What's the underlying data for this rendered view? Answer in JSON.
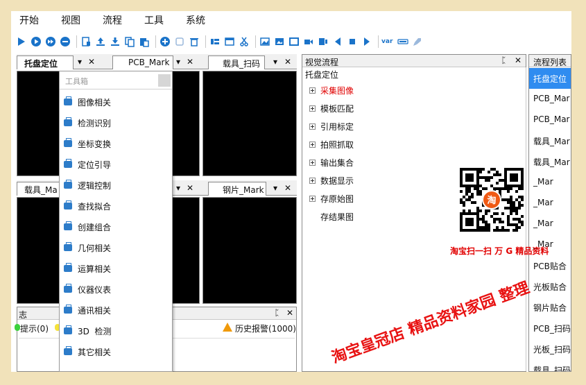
{
  "menu": [
    "开始",
    "视图",
    "流程",
    "工具",
    "系统"
  ],
  "toolbar": {
    "icons": [
      "run-icon",
      "run-once-icon",
      "step-icon",
      "stop-icon",
      "save-icon",
      "upload-icon",
      "download-icon",
      "copy-icon",
      "paste-icon",
      "add-icon",
      "duplicate-icon",
      "delete-icon",
      "list-icon",
      "window-icon",
      "cut-icon",
      "image-icon",
      "image-edit-icon",
      "frame-icon",
      "camera-icon",
      "layers-icon",
      "prev-icon",
      "square-icon",
      "next-icon",
      "var-icon",
      "io-icon",
      "rocket-icon"
    ],
    "var_label": "var",
    "accent": "#1a73c9"
  },
  "panes": {
    "tab1": "托盘定位",
    "tab2": "PCB_Mark",
    "tab3": "载具_扫码",
    "tab4": "载具_Ma",
    "tab5": "钢片_Mark",
    "pin": "▾",
    "close": "✕"
  },
  "toolbox": {
    "title": "工具箱",
    "items": [
      "图像相关",
      "检测识别",
      "坐标变换",
      "定位引导",
      "逻辑控制",
      "查找拟合",
      "创建组合",
      "几何相关",
      "运算相关",
      "仪器仪表",
      "通讯相关",
      "3D  检测",
      "其它相关"
    ]
  },
  "log": {
    "title": "志",
    "pin": "ᛈ",
    "close": "✕",
    "hint": "提示(0)",
    "history": "历史报警(1000)"
  },
  "vflow": {
    "title": "视觉流程",
    "subtitle": "托盘定位",
    "pin": "ᛈ",
    "close": "✕",
    "items": [
      {
        "label": "采集图像",
        "color": "#e00000",
        "expandable": true
      },
      {
        "label": "模板匹配",
        "color": "#111111",
        "expandable": true
      },
      {
        "label": "引用标定",
        "color": "#111111",
        "expandable": true
      },
      {
        "label": "拍照抓取",
        "color": "#111111",
        "expandable": true
      },
      {
        "label": "输出集合",
        "color": "#111111",
        "expandable": true
      },
      {
        "label": "数据显示",
        "color": "#111111",
        "expandable": true
      },
      {
        "label": "存原始图",
        "color": "#111111",
        "expandable": true
      },
      {
        "label": "存结果图",
        "color": "#111111",
        "expandable": false
      }
    ]
  },
  "plist": {
    "title": "流程列表",
    "items": [
      "托盘定位",
      "PCB_Mar",
      "PCB_Mar",
      "载具_Mar",
      "载具_Mar",
      "_Mar",
      "_Mar",
      "_Mar",
      "_Mar",
      "PCB贴合",
      "光板贴合",
      "钢片贴合",
      "PCB_扫码",
      "光板_扫码",
      "载具_扫码"
    ],
    "selected_color": "#2f8cf0"
  },
  "overlay": {
    "qr_badge": "淘",
    "qr_caption": "淘宝扫一扫  万 G 精品资料",
    "watermark": "淘宝皇冠店 精品资料家园 整理",
    "watermark_color": "#e81212"
  }
}
